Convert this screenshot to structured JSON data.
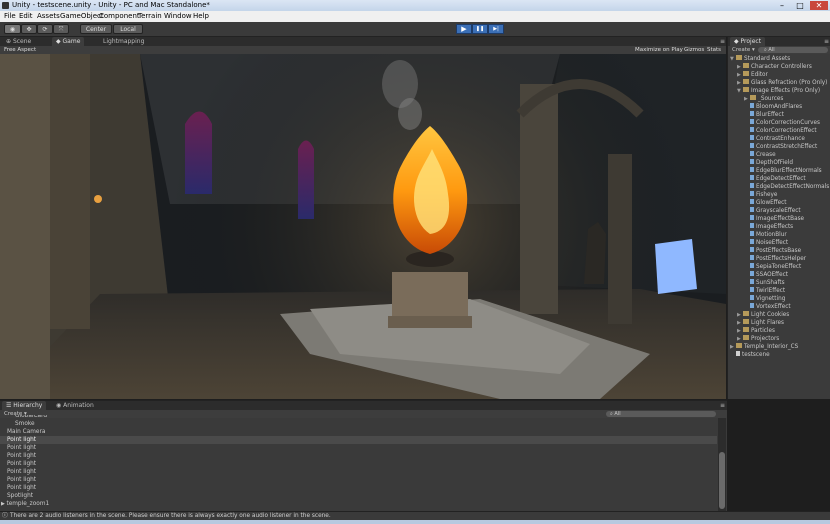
{
  "window": {
    "title": "Unity - testscene.unity - Unity - PC and Mac Standalone*",
    "minimize": "–",
    "maximize": "□",
    "close": "✕"
  },
  "menu": [
    "File",
    "Edit",
    "Assets",
    "GameObject",
    "Component",
    "Terrain",
    "Window",
    "Help"
  ],
  "toolbar": {
    "pivot": "Center",
    "space": "Local",
    "play": "▶",
    "pause": "❚❚",
    "step": "▶|"
  },
  "tabs": {
    "scene": "Scene",
    "game": "Game",
    "lightmapping": "Lightmapping"
  },
  "game_bar": {
    "aspect": "Free Aspect",
    "maximize": "Maximize on Play",
    "gizmos": "Gizmos",
    "stats": "Stats"
  },
  "project": {
    "tab": "Project",
    "create": "Create ▾",
    "search": "All",
    "items": [
      {
        "label": "Standard Assets",
        "indent": 0,
        "type": "folder",
        "open": true
      },
      {
        "label": "Character Controllers",
        "indent": 1,
        "type": "folder",
        "open": false
      },
      {
        "label": "Editor",
        "indent": 1,
        "type": "folder",
        "open": false
      },
      {
        "label": "Glass Refraction (Pro Only)",
        "indent": 1,
        "type": "folder",
        "open": false
      },
      {
        "label": "Image Effects (Pro Only)",
        "indent": 1,
        "type": "folder",
        "open": true
      },
      {
        "label": "_Sources",
        "indent": 2,
        "type": "folder",
        "open": false
      },
      {
        "label": "BloomAndFlares",
        "indent": 2,
        "type": "file"
      },
      {
        "label": "BlurEffect",
        "indent": 2,
        "type": "file"
      },
      {
        "label": "ColorCorrectionCurves",
        "indent": 2,
        "type": "file"
      },
      {
        "label": "ColorCorrectionEffect",
        "indent": 2,
        "type": "file"
      },
      {
        "label": "ContrastEnhance",
        "indent": 2,
        "type": "file"
      },
      {
        "label": "ContrastStretchEffect",
        "indent": 2,
        "type": "file"
      },
      {
        "label": "Crease",
        "indent": 2,
        "type": "file"
      },
      {
        "label": "DepthOfField",
        "indent": 2,
        "type": "file"
      },
      {
        "label": "EdgeBlurEffectNormals",
        "indent": 2,
        "type": "file"
      },
      {
        "label": "EdgeDetectEffect",
        "indent": 2,
        "type": "file"
      },
      {
        "label": "EdgeDetectEffectNormals",
        "indent": 2,
        "type": "file"
      },
      {
        "label": "Fisheye",
        "indent": 2,
        "type": "file"
      },
      {
        "label": "GlowEffect",
        "indent": 2,
        "type": "file"
      },
      {
        "label": "GrayscaleEffect",
        "indent": 2,
        "type": "file"
      },
      {
        "label": "ImageEffectBase",
        "indent": 2,
        "type": "file"
      },
      {
        "label": "ImageEffects",
        "indent": 2,
        "type": "file"
      },
      {
        "label": "MotionBlur",
        "indent": 2,
        "type": "file"
      },
      {
        "label": "NoiseEffect",
        "indent": 2,
        "type": "file"
      },
      {
        "label": "PostEffectsBase",
        "indent": 2,
        "type": "file"
      },
      {
        "label": "PostEffectsHelper",
        "indent": 2,
        "type": "file"
      },
      {
        "label": "SepiaToneEffect",
        "indent": 2,
        "type": "file"
      },
      {
        "label": "SSAOEffect",
        "indent": 2,
        "type": "file"
      },
      {
        "label": "SunShafts",
        "indent": 2,
        "type": "file"
      },
      {
        "label": "TwirlEffect",
        "indent": 2,
        "type": "file"
      },
      {
        "label": "Vignetting",
        "indent": 2,
        "type": "file"
      },
      {
        "label": "VortexEffect",
        "indent": 2,
        "type": "file"
      },
      {
        "label": "Light Cookies",
        "indent": 1,
        "type": "folder",
        "open": false
      },
      {
        "label": "Light Flares",
        "indent": 1,
        "type": "folder",
        "open": false
      },
      {
        "label": "Particles",
        "indent": 1,
        "type": "folder",
        "open": false
      },
      {
        "label": "Projectors",
        "indent": 1,
        "type": "folder",
        "open": false
      },
      {
        "label": "Temple_Interior_CS",
        "indent": 0,
        "type": "folder",
        "open": false
      },
      {
        "label": "testscene",
        "indent": 0,
        "type": "scene"
      }
    ]
  },
  "hierarchy": {
    "tab": "Hierarchy",
    "tab2": "Animation",
    "create": "Create ▾",
    "search": "All",
    "items": [
      {
        "label": "GlobalCard",
        "indent": 1,
        "selected": false
      },
      {
        "label": "Smoke",
        "indent": 1,
        "selected": false
      },
      {
        "label": "Main Camera",
        "indent": 0,
        "selected": false
      },
      {
        "label": "Point light",
        "indent": 0,
        "selected": true
      },
      {
        "label": "Point light",
        "indent": 0,
        "selected": false
      },
      {
        "label": "Point light",
        "indent": 0,
        "selected": false
      },
      {
        "label": "Point light",
        "indent": 0,
        "selected": false
      },
      {
        "label": "Point light",
        "indent": 0,
        "selected": false
      },
      {
        "label": "Point light",
        "indent": 0,
        "selected": false
      },
      {
        "label": "Point light",
        "indent": 0,
        "selected": false
      },
      {
        "label": "Spotlight",
        "indent": 0,
        "selected": false
      },
      {
        "label": "temple_zoom1",
        "indent": 0,
        "selected": false,
        "arrow": true
      }
    ]
  },
  "status": "There are 2 audio listeners in the scene. Please ensure there is always exactly one audio listener in the scene."
}
